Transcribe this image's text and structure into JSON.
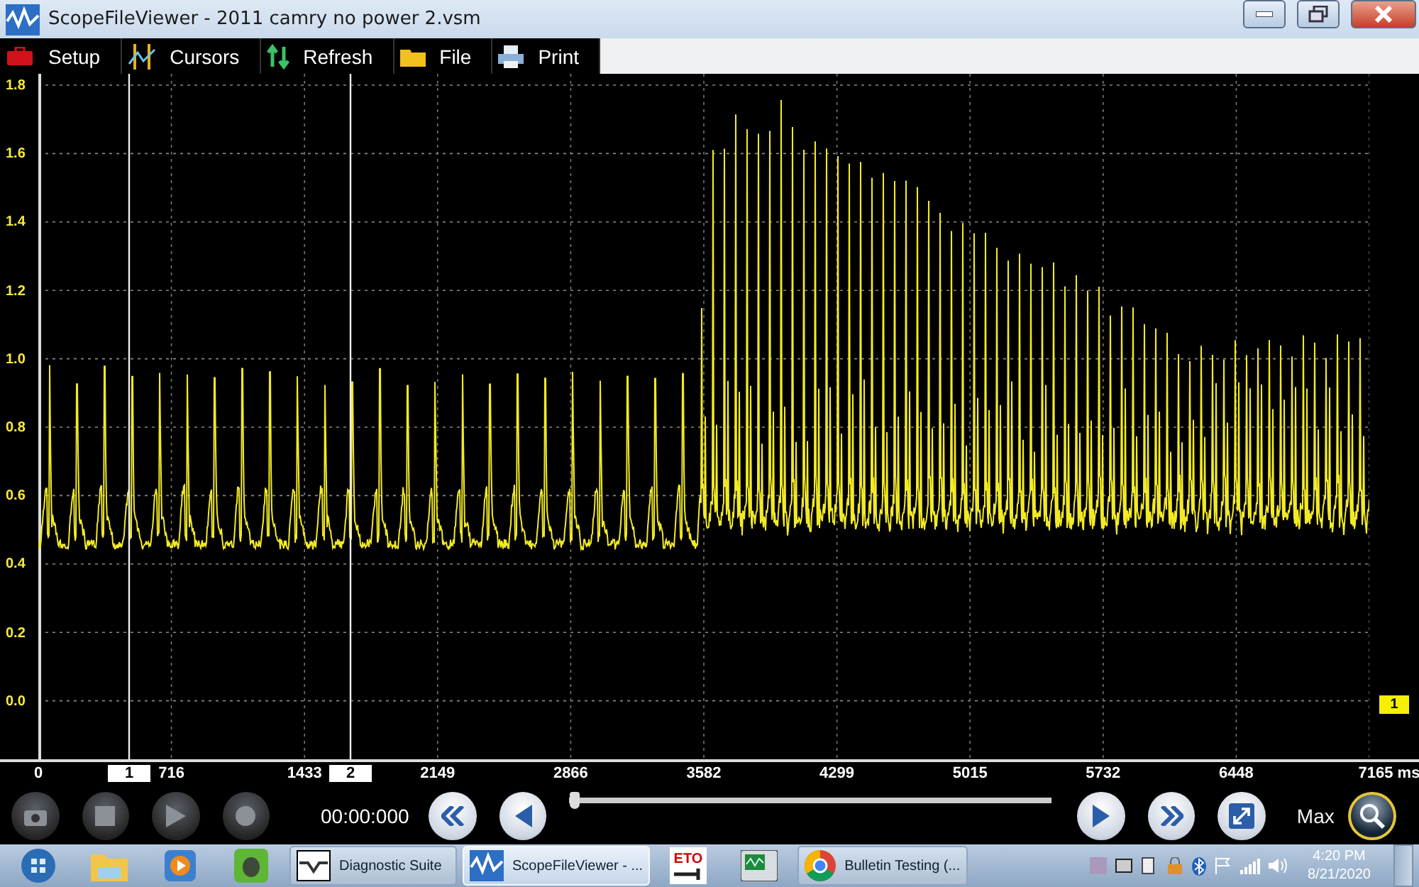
{
  "window": {
    "title": "ScopeFileViewer - 2011 camry no power 2.vsm"
  },
  "toolbar": [
    {
      "kind": "setup",
      "label": "Setup"
    },
    {
      "kind": "cursors",
      "label": "Cursors"
    },
    {
      "kind": "refresh",
      "label": "Refresh"
    },
    {
      "kind": "file",
      "label": "File"
    },
    {
      "kind": "print",
      "label": "Print"
    }
  ],
  "plot": {
    "y_axis_labels": [
      "1.8",
      "1.6",
      "1.4",
      "1.2",
      "1.0",
      "0.8",
      "0.6",
      "0.4",
      "0.2",
      "0.0"
    ],
    "x_axis_labels": [
      "0",
      "716",
      "1433",
      "2149",
      "2866",
      "3582",
      "4299",
      "5015",
      "5732",
      "6448",
      "7165 ms"
    ],
    "cursors": [
      {
        "label": "1"
      },
      {
        "label": "2"
      }
    ],
    "channel_marker": "1"
  },
  "controls": {
    "transport": [
      {
        "kind": "snapshot",
        "disabled": true
      },
      {
        "kind": "stop",
        "disabled": true
      },
      {
        "kind": "play",
        "disabled": true
      },
      {
        "kind": "record",
        "disabled": true
      }
    ],
    "time": "00:00:000",
    "slider": {
      "level": 0
    },
    "zoom_label": "Max"
  },
  "taskbar": {
    "items": [
      {
        "kind": "start"
      },
      {
        "kind": "folder"
      },
      {
        "kind": "media"
      },
      {
        "kind": "notes"
      },
      {
        "kind": "diag-window",
        "label": "Diagnostic Suite",
        "selected": false
      },
      {
        "kind": "scope-window",
        "label": "ScopeFileViewer - ...",
        "selected": true
      },
      {
        "kind": "eto",
        "label": "ETO"
      },
      {
        "kind": "scope-app"
      },
      {
        "kind": "browser-window",
        "label": "Bulletin Testing (...",
        "selected": false
      }
    ],
    "clock": {
      "time": "4:20 PM",
      "date": "8/21/2020"
    }
  }
}
